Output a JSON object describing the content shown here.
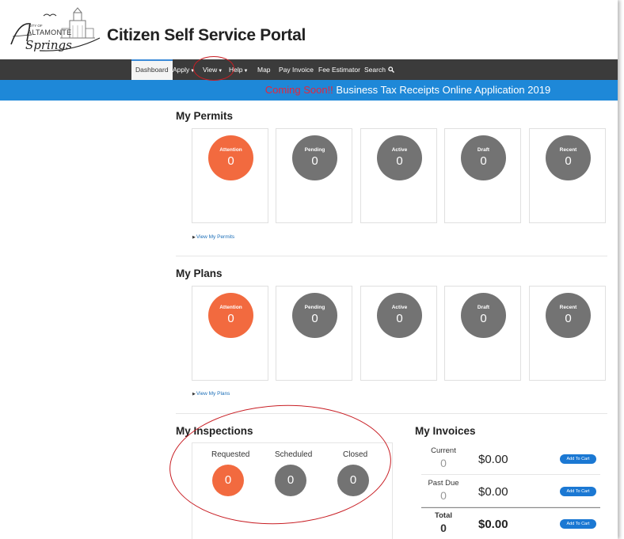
{
  "header": {
    "logo_city_of": "CITY OF",
    "logo_altamonte": "ALTAMONTE",
    "logo_springs": "Springs",
    "title": "Citizen Self Service Portal"
  },
  "nav": {
    "items": [
      {
        "label": "Dashboard",
        "active": true
      },
      {
        "label": "Apply",
        "dropdown": true
      },
      {
        "label": "View",
        "dropdown": true
      },
      {
        "label": "Help",
        "dropdown": true
      },
      {
        "label": "Map"
      },
      {
        "label": "Pay Invoice"
      },
      {
        "label": "Fee Estimator"
      },
      {
        "label": "Search",
        "icon": "search-icon"
      }
    ]
  },
  "banner": {
    "highlight": "Coming Soon!!",
    "text": "Business Tax Receipts Online Application 2019"
  },
  "permits": {
    "title": "My Permits",
    "cards": [
      {
        "label": "Attention",
        "value": "0",
        "color": "#f26a3f"
      },
      {
        "label": "Pending",
        "value": "0",
        "color": "#737373"
      },
      {
        "label": "Active",
        "value": "0",
        "color": "#737373"
      },
      {
        "label": "Draft",
        "value": "0",
        "color": "#737373"
      },
      {
        "label": "Recent",
        "value": "0",
        "color": "#737373"
      }
    ],
    "link": "View My Permits"
  },
  "plans": {
    "title": "My Plans",
    "cards": [
      {
        "label": "Attention",
        "value": "0",
        "color": "#f26a3f"
      },
      {
        "label": "Pending",
        "value": "0",
        "color": "#737373"
      },
      {
        "label": "Active",
        "value": "0",
        "color": "#737373"
      },
      {
        "label": "Draft",
        "value": "0",
        "color": "#737373"
      },
      {
        "label": "Recent",
        "value": "0",
        "color": "#737373"
      }
    ],
    "link": "View My Plans"
  },
  "inspections": {
    "title": "My Inspections",
    "items": [
      {
        "label": "Requested",
        "value": "0",
        "color": "#f26a3f"
      },
      {
        "label": "Scheduled",
        "value": "0",
        "color": "#737373"
      },
      {
        "label": "Closed",
        "value": "0",
        "color": "#737373"
      }
    ]
  },
  "invoices": {
    "title": "My Invoices",
    "rows": [
      {
        "label": "Current",
        "count": "0",
        "amount": "$0.00",
        "button": "Add To Cart"
      },
      {
        "label": "Past Due",
        "count": "0",
        "amount": "$0.00",
        "button": "Add To Cart"
      },
      {
        "label": "Total",
        "count": "0",
        "amount": "$0.00",
        "button": "Add To Cart"
      }
    ]
  },
  "colors": {
    "nav_bg": "#3b3b3b",
    "banner_bg": "#1e88d8",
    "attention": "#f26a3f",
    "neutral": "#737373",
    "link": "#1d6fb8",
    "annotation": "#c81e24"
  }
}
